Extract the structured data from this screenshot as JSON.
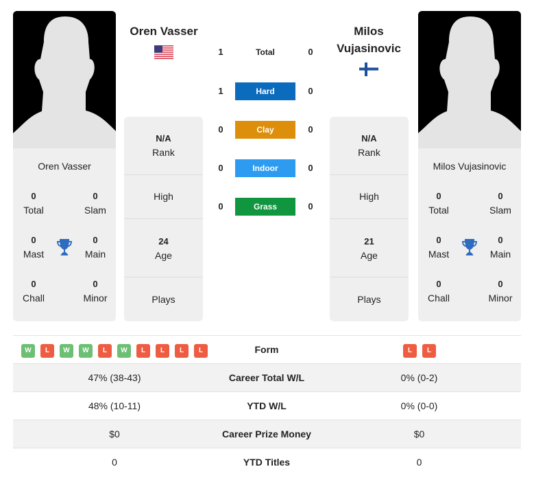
{
  "player_left": {
    "name": "Oren Vasser",
    "country_flag": "us-flag-icon",
    "titles": {
      "total": "0",
      "slam": "0",
      "mast": "0",
      "main": "0",
      "chall": "0",
      "minor": "0"
    },
    "rank_value": "N/A",
    "high_value": "",
    "age_value": "24",
    "plays_value": ""
  },
  "player_right": {
    "name": "Milos Vujasinovic",
    "country_flag": "finland-flag-icon",
    "titles": {
      "total": "0",
      "slam": "0",
      "mast": "0",
      "main": "0",
      "chall": "0",
      "minor": "0"
    },
    "rank_value": "N/A",
    "high_value": "",
    "age_value": "21",
    "plays_value": ""
  },
  "labels": {
    "total": "Total",
    "slam": "Slam",
    "mast": "Mast",
    "main": "Main",
    "chall": "Chall",
    "minor": "Minor",
    "rank": "Rank",
    "high": "High",
    "age": "Age",
    "plays": "Plays"
  },
  "h2h": [
    {
      "label": "Total",
      "left": "1",
      "right": "0",
      "color": ""
    },
    {
      "label": "Hard",
      "left": "1",
      "right": "0",
      "color": "#0b6bbd"
    },
    {
      "label": "Clay",
      "left": "0",
      "right": "0",
      "color": "#dd8e0a"
    },
    {
      "label": "Indoor",
      "left": "0",
      "right": "0",
      "color": "#2d9bf0"
    },
    {
      "label": "Grass",
      "left": "0",
      "right": "0",
      "color": "#10963e"
    }
  ],
  "comparison": {
    "form_label": "Form",
    "form_left": [
      "W",
      "L",
      "W",
      "W",
      "L",
      "W",
      "L",
      "L",
      "L",
      "L"
    ],
    "form_right": [
      "L",
      "L"
    ],
    "rows": [
      {
        "label": "Career Total W/L",
        "left": "47% (38-43)",
        "right": "0% (0-2)"
      },
      {
        "label": "YTD W/L",
        "left": "48% (10-11)",
        "right": "0% (0-0)"
      },
      {
        "label": "Career Prize Money",
        "left": "$0",
        "right": "$0"
      },
      {
        "label": "YTD Titles",
        "left": "0",
        "right": "0"
      }
    ]
  },
  "colors": {
    "win": "#6cbf73",
    "loss": "#ee5d42",
    "trophy": "#2f6bbf"
  }
}
